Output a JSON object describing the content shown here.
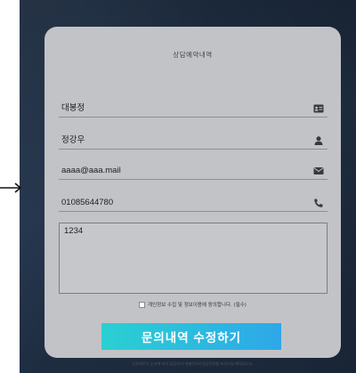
{
  "form": {
    "title": "상담예약내역",
    "fields": {
      "name": "대봉정",
      "manager": "정강우",
      "email": "aaaa@aaa.mail",
      "phone": "01085644780",
      "message": "1234"
    },
    "agree_label": "개인정보 수집 및 정보이용에 동의합니다. (필수)",
    "submit_label": "문의내역 수정하기",
    "notice": "신청해주신 순서에 따라 담당자가 개별적으로상담전화를 최선드릴 예정입니다."
  },
  "icons": {
    "name": "id-card-icon",
    "manager": "user-icon",
    "email": "envelope-icon",
    "phone": "phone-icon",
    "arrow": "arrow-right-icon"
  },
  "colors": {
    "card_bg": "#c2c3c6",
    "page_bg": "#1f2e44",
    "button_start": "#2ad0d2",
    "button_end": "#2ea7e9"
  }
}
